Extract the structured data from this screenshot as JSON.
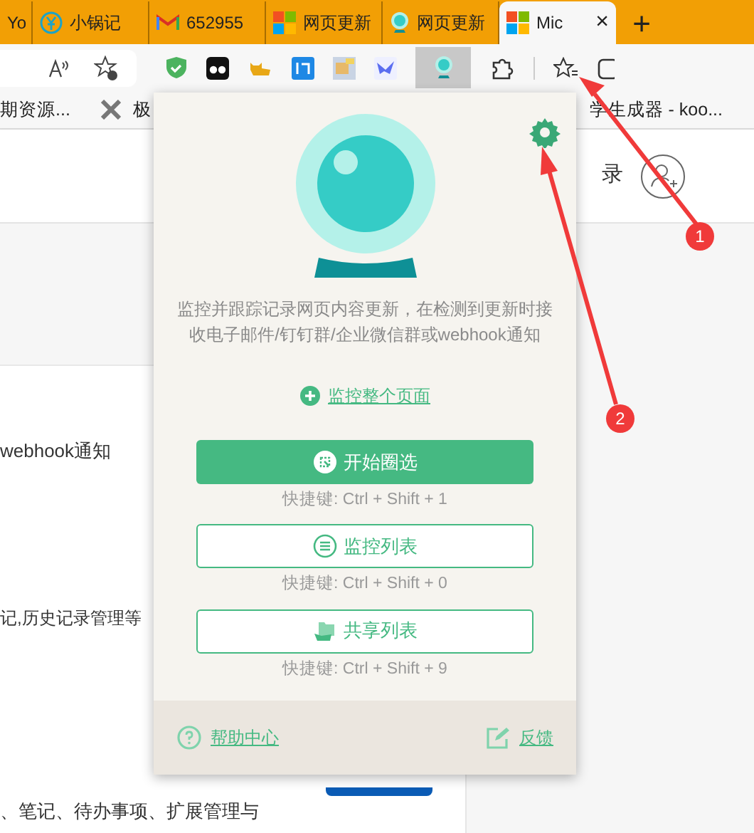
{
  "tabs": [
    {
      "title": "Yo",
      "selected": false
    },
    {
      "title": "小锅记",
      "selected": false
    },
    {
      "title": "652955",
      "selected": false
    },
    {
      "title": "网页更新",
      "selected": false
    },
    {
      "title": "网页更新",
      "selected": false
    },
    {
      "title": "Mic",
      "selected": true
    }
  ],
  "close_tab": "×",
  "new_tab": "+",
  "bookmarks": [
    {
      "title": "期资源..."
    },
    {
      "title": "极"
    },
    {
      "title": "学生成器 - koo..."
    }
  ],
  "page": {
    "login": "录",
    "texts": [
      "webhook通知",
      "记,历史记录管理等",
      "、笔记、待办事项、扩展管理与"
    ]
  },
  "popup": {
    "description": "监控并跟踪记录网页内容更新，在检测到更新时接收电子邮件/钉钉群/企业微信群或webhook通知",
    "monitor_page": "监控整个页面",
    "actions": [
      {
        "label": "开始圈选",
        "shortcut": "快捷键: Ctrl + Shift + 1",
        "kind": "primary"
      },
      {
        "label": "监控列表",
        "shortcut": "快捷键: Ctrl + Shift + 0",
        "kind": "outline"
      },
      {
        "label": "共享列表",
        "shortcut": "快捷键: Ctrl + Shift + 9",
        "kind": "outline"
      }
    ],
    "help": "帮助中心",
    "feedback": "反馈"
  },
  "annotations": [
    "1",
    "2"
  ]
}
